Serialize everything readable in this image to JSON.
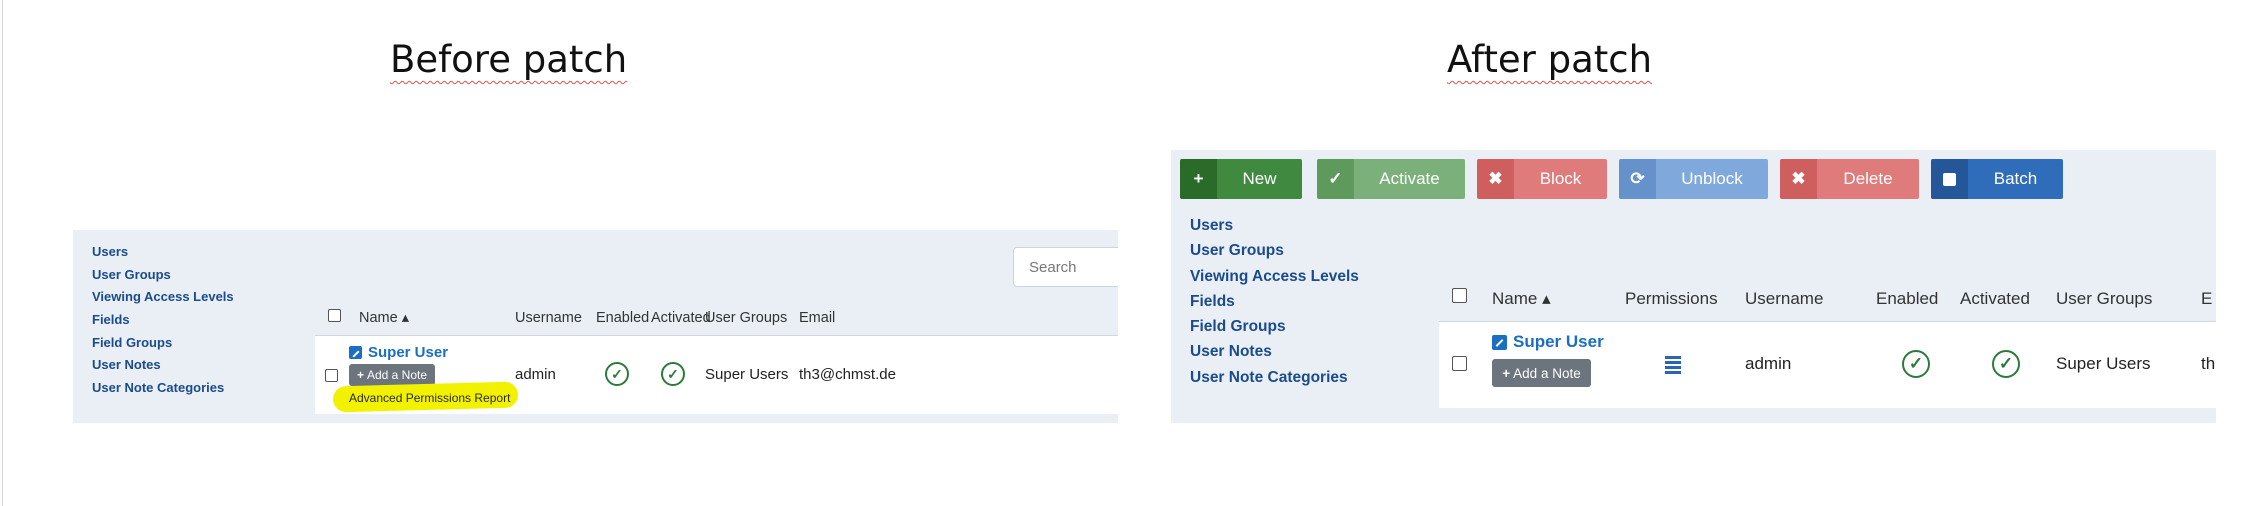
{
  "headings": {
    "before": "Before patch",
    "after": "After patch"
  },
  "colors": {
    "link": "#1a6fc4",
    "nav": "#1a4c8b",
    "success": "#2d7a3a",
    "highlight": "#f2f200",
    "panel_bg": "#eaeef5"
  },
  "before": {
    "sidebar": [
      "Users",
      "User Groups",
      "Viewing Access Levels",
      "Fields",
      "Field Groups",
      "User Notes",
      "User Note Categories"
    ],
    "search_placeholder": "Search",
    "columns": [
      "Name ▴",
      "Username",
      "Enabled",
      "Activated",
      "User Groups",
      "Email"
    ],
    "row": {
      "name": "Super User",
      "add_note": "Add a Note",
      "report_link": "Advanced Permissions Report",
      "username": "admin",
      "enabled": "✓",
      "activated": "✓",
      "user_groups": "Super Users",
      "email": "th3@chmst.de"
    }
  },
  "after": {
    "toolbar": [
      {
        "label": "New",
        "icon": "+",
        "icon_name": "plus-icon",
        "bg": "#3f8a3e",
        "icon_bg": "#2a6b2a"
      },
      {
        "label": "Activate",
        "icon": "✓",
        "icon_name": "check-icon",
        "bg": "#7cb07a",
        "icon_bg": "#5d9a5c"
      },
      {
        "label": "Block",
        "icon": "✖",
        "icon_name": "times-icon",
        "bg": "#df7b7b",
        "icon_bg": "#cf5e5e"
      },
      {
        "label": "Unblock",
        "icon": "⟳",
        "icon_name": "refresh-icon",
        "bg": "#7fa9dc",
        "icon_bg": "#6592cb"
      },
      {
        "label": "Delete",
        "icon": "✖",
        "icon_name": "times-icon",
        "bg": "#df7b7b",
        "icon_bg": "#cf5e5e"
      },
      {
        "label": "Batch",
        "icon": "",
        "icon_name": "square-icon",
        "bg": "#2f6cb9",
        "icon_bg": "#24579a"
      }
    ],
    "sidebar": [
      "Users",
      "User Groups",
      "Viewing Access Levels",
      "Fields",
      "Field Groups",
      "User Notes",
      "User Note Categories"
    ],
    "columns": [
      "Name ▴",
      "Permissions",
      "Username",
      "Enabled",
      "Activated",
      "User Groups",
      "E"
    ],
    "row": {
      "name": "Super User",
      "add_note": "Add a Note",
      "username": "admin",
      "enabled": "✓",
      "activated": "✓",
      "user_groups": "Super Users",
      "email": "th"
    }
  }
}
